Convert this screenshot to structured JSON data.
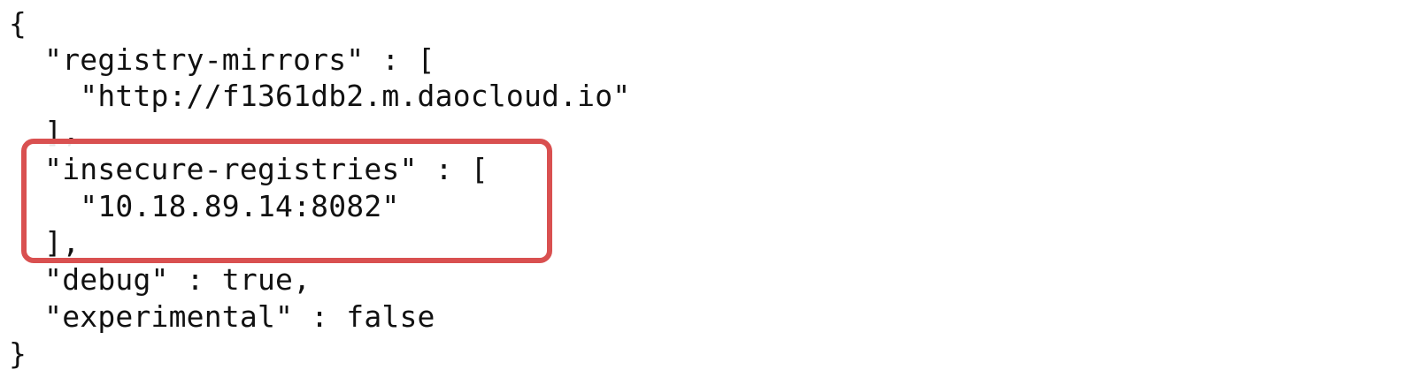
{
  "code": {
    "lines": [
      "{",
      "  \"registry-mirrors\" : [",
      "    \"http://f1361db2.m.daocloud.io\"",
      "  ],",
      "  \"insecure-registries\" : [",
      "    \"10.18.89.14:8082\"",
      "  ],",
      "  \"debug\" : true,",
      "  \"experimental\" : false",
      "}"
    ]
  },
  "highlight": {
    "color": "#d95050"
  }
}
